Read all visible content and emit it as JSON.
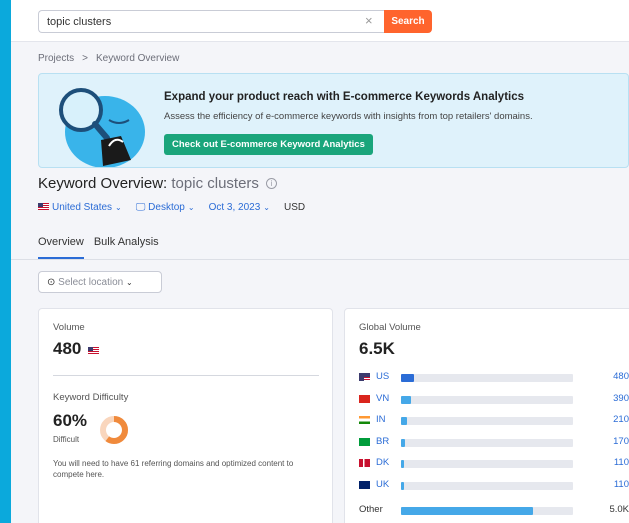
{
  "search": {
    "query": "topic clusters",
    "clear_glyph": "×",
    "button_label": "Search"
  },
  "breadcrumb": {
    "items": [
      "Projects",
      "Keyword Overview"
    ],
    "separator": ">"
  },
  "banner": {
    "title": "Expand your product reach with E-commerce Keywords Analytics",
    "subtitle": "Assess the efficiency of e-commerce keywords with insights from top retailers' domains.",
    "button_label": "Check out E-commerce Keyword Analytics"
  },
  "header": {
    "title_prefix": "Keyword Overview:",
    "keyword": "topic clusters",
    "info_glyph": "i"
  },
  "filters": {
    "country": "United States",
    "device": "Desktop",
    "date": "Oct 3, 2023",
    "currency": "USD"
  },
  "tabs": [
    {
      "label": "Overview",
      "active": true
    },
    {
      "label": "Bulk Analysis",
      "active": false
    }
  ],
  "location_select": {
    "placeholder": "Select location"
  },
  "volume_card": {
    "label": "Volume",
    "value": "480",
    "kd_label": "Keyword Difficulty",
    "kd_value": "60%",
    "kd_level": "Difficult",
    "kd_fraction": 0.6,
    "kd_note": "You will need to have 61 referring domains and optimized content to compete here."
  },
  "global_volume": {
    "label": "Global Volume",
    "total": "6.5K",
    "rows": [
      {
        "code": "US",
        "value": "480",
        "fraction": 0.074,
        "flag": "us"
      },
      {
        "code": "VN",
        "value": "390",
        "fraction": 0.06,
        "flag": "vn"
      },
      {
        "code": "IN",
        "value": "210",
        "fraction": 0.032,
        "flag": "in"
      },
      {
        "code": "BR",
        "value": "170",
        "fraction": 0.026,
        "flag": "br"
      },
      {
        "code": "DK",
        "value": "110",
        "fraction": 0.017,
        "flag": "dk"
      },
      {
        "code": "UK",
        "value": "110",
        "fraction": 0.017,
        "flag": "uk"
      },
      {
        "code": "Other",
        "value": "5.0K",
        "fraction": 0.77,
        "flag": "none"
      }
    ]
  },
  "colors": {
    "accent": "#2b6cd6",
    "search_button": "#ff642d",
    "banner_button": "#1aa57b",
    "kd_donut": "#f08a3c",
    "background": "#0ba9dc"
  }
}
